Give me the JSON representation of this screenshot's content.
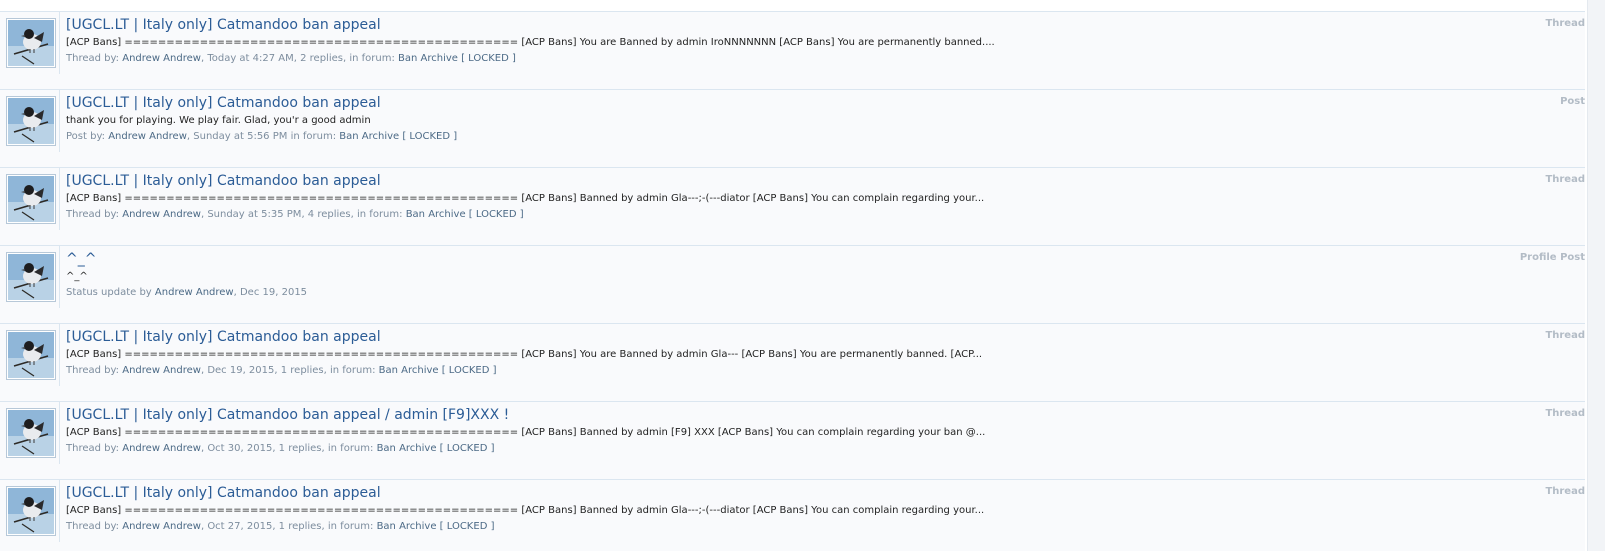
{
  "results": [
    {
      "type": "Thread",
      "title": "[UGCL.LT | Italy only] Catmandoo ban appeal",
      "snippet": "[ACP Bans] =============================================== [ACP Bans] You are Banned by admin IroNNNNNNN [ACP Bans] You are permanently banned....",
      "meta": {
        "prefix": "Thread by:",
        "author": "Andrew Andrew",
        "sep1": ",",
        "date": "Today at 4:27 AM",
        "details": ", 2 replies, in forum:",
        "forum": "Ban Archive [ LOCKED ]"
      }
    },
    {
      "type": "Post",
      "title": "[UGCL.LT | Italy only] Catmandoo ban appeal",
      "snippet": "thank you for playing. We play fair. Glad, you'r a good admin",
      "meta": {
        "prefix": "Post by:",
        "author": "Andrew Andrew",
        "sep1": ",",
        "date": "Sunday at 5:56 PM",
        "details": " in forum:",
        "forum": "Ban Archive [ LOCKED ]"
      }
    },
    {
      "type": "Thread",
      "title": "[UGCL.LT | Italy only] Catmandoo ban appeal",
      "snippet": "[ACP Bans] =============================================== [ACP Bans] Banned by admin Gla---;-(---diator [ACP Bans] You can complain regarding your...",
      "meta": {
        "prefix": "Thread by:",
        "author": "Andrew Andrew",
        "sep1": ",",
        "date": "Sunday at 5:35 PM",
        "details": ", 4 replies, in forum:",
        "forum": "Ban Archive [ LOCKED ]"
      }
    },
    {
      "type": "Profile Post",
      "title": "^_^",
      "snippet": "^_^",
      "meta": {
        "prefix": "Status update by",
        "author": "Andrew Andrew",
        "sep1": ",",
        "date": "Dec 19, 2015",
        "details": "",
        "forum": ""
      }
    },
    {
      "type": "Thread",
      "title": "[UGCL.LT | Italy only] Catmandoo ban appeal",
      "snippet": "[ACP Bans] =============================================== [ACP Bans] You are Banned by admin Gla--- [ACP Bans] You are permanently banned. [ACP...",
      "meta": {
        "prefix": "Thread by:",
        "author": "Andrew Andrew",
        "sep1": ",",
        "date": "Dec 19, 2015",
        "details": ", 1 replies, in forum:",
        "forum": "Ban Archive [ LOCKED ]"
      }
    },
    {
      "type": "Thread",
      "title": "[UGCL.LT | Italy only] Catmandoo ban appeal / admin [F9]XXX !",
      "snippet": "[ACP Bans] =============================================== [ACP Bans] Banned by admin [F9] XXX [ACP Bans] You can complain regarding your ban @...",
      "meta": {
        "prefix": "Thread by:",
        "author": "Andrew Andrew",
        "sep1": ",",
        "date": "Oct 30, 2015",
        "details": ", 1 replies, in forum:",
        "forum": "Ban Archive [ LOCKED ]"
      }
    },
    {
      "type": "Thread",
      "title": "[UGCL.LT | Italy only] Catmandoo ban appeal",
      "snippet": "[ACP Bans] =============================================== [ACP Bans] Banned by admin Gla---;-(---diator [ACP Bans] You can complain regarding your...",
      "meta": {
        "prefix": "Thread by:",
        "author": "Andrew Andrew",
        "sep1": ",",
        "date": "Oct 27, 2015",
        "details": ", 1 replies, in forum:",
        "forum": "Ban Archive [ LOCKED ]"
      }
    }
  ],
  "colors": {
    "title_link": "#2b5c96",
    "meta_text": "#7d8d9e",
    "type_label": "#b3bcc6",
    "row_border": "#dbe6f0"
  }
}
